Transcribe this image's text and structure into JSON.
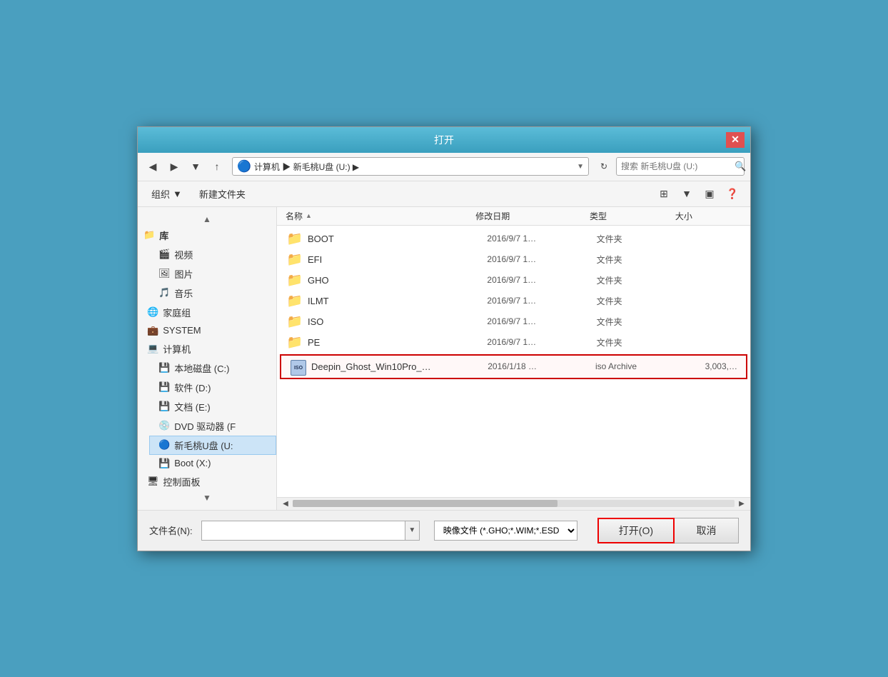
{
  "dialog": {
    "title": "打开",
    "close_label": "✕"
  },
  "toolbar": {
    "back_label": "◀",
    "forward_label": "▶",
    "dropdown_label": "▼",
    "up_label": "↑",
    "address": "计算机 ▶ 新毛桃U盘 (U:) ▶",
    "address_dropdown": "▼",
    "refresh_label": "↻",
    "search_placeholder": "搜索 新毛桃U盘 (U:)",
    "search_icon": "🔍"
  },
  "toolbar2": {
    "organize_label": "组织",
    "organize_arrow": "▼",
    "new_folder_label": "新建文件夹",
    "view_icon": "⊞",
    "view_arrow": "▼",
    "panel_icon": "▣",
    "help_icon": "❓"
  },
  "sidebar": {
    "scroll_up": "▲",
    "scroll_down": "▼",
    "items": [
      {
        "id": "library",
        "label": "库",
        "icon": "📁",
        "indent": 0,
        "bold": true
      },
      {
        "id": "video",
        "label": "视频",
        "icon": "🎬",
        "indent": 1
      },
      {
        "id": "images",
        "label": "图片",
        "icon": "🖼",
        "indent": 1
      },
      {
        "id": "music",
        "label": "音乐",
        "icon": "🎵",
        "indent": 1
      },
      {
        "id": "homegroup",
        "label": "家庭组",
        "icon": "🌐",
        "indent": 0
      },
      {
        "id": "system",
        "label": "SYSTEM",
        "icon": "💼",
        "indent": 0
      },
      {
        "id": "computer",
        "label": "计算机",
        "icon": "💻",
        "indent": 0
      },
      {
        "id": "local-c",
        "label": "本地磁盘 (C:)",
        "icon": "💾",
        "indent": 1
      },
      {
        "id": "soft-d",
        "label": "软件 (D:)",
        "icon": "💾",
        "indent": 1
      },
      {
        "id": "doc-e",
        "label": "文档 (E:)",
        "icon": "💾",
        "indent": 1
      },
      {
        "id": "dvd-f",
        "label": "DVD 驱动器 (F",
        "icon": "💿",
        "indent": 1
      },
      {
        "id": "usb-u",
        "label": "新毛桃U盘 (U:",
        "icon": "🔵",
        "indent": 1,
        "active": true
      },
      {
        "id": "boot-x",
        "label": "Boot (X:)",
        "icon": "💾",
        "indent": 1
      },
      {
        "id": "control",
        "label": "控制面板",
        "icon": "🖥",
        "indent": 0
      }
    ]
  },
  "file_list": {
    "headers": {
      "name": "名称",
      "name_arrow": "▲",
      "date": "修改日期",
      "type": "类型",
      "size": "大小"
    },
    "items": [
      {
        "id": "boot",
        "name": "BOOT",
        "date": "2016/9/7 1…",
        "type": "文件夹",
        "size": "",
        "icon": "📁",
        "highlighted": false
      },
      {
        "id": "efi",
        "name": "EFI",
        "date": "2016/9/7 1…",
        "type": "文件夹",
        "size": "",
        "icon": "📁",
        "highlighted": false
      },
      {
        "id": "gho",
        "name": "GHO",
        "date": "2016/9/7 1…",
        "type": "文件夹",
        "size": "",
        "icon": "📁",
        "highlighted": false
      },
      {
        "id": "ilmt",
        "name": "ILMT",
        "date": "2016/9/7 1…",
        "type": "文件夹",
        "size": "",
        "icon": "📁",
        "highlighted": false
      },
      {
        "id": "iso",
        "name": "ISO",
        "date": "2016/9/7 1…",
        "type": "文件夹",
        "size": "",
        "icon": "📁",
        "highlighted": false
      },
      {
        "id": "pe",
        "name": "PE",
        "date": "2016/9/7 1…",
        "type": "文件夹",
        "size": "",
        "icon": "📁",
        "highlighted": false
      },
      {
        "id": "deepin",
        "name": "Deepin_Ghost_Win10Pro_…",
        "date": "2016/1/18 …",
        "type": "iso Archive",
        "size": "3,003,…",
        "icon": "ISO",
        "highlighted": true
      }
    ]
  },
  "bottom": {
    "filename_label": "文件名(N):",
    "filename_value": "",
    "filetype_label": "映像文件 (*.GHO;*.WIM;*.ESD",
    "open_label": "打开(O)",
    "cancel_label": "取消"
  }
}
